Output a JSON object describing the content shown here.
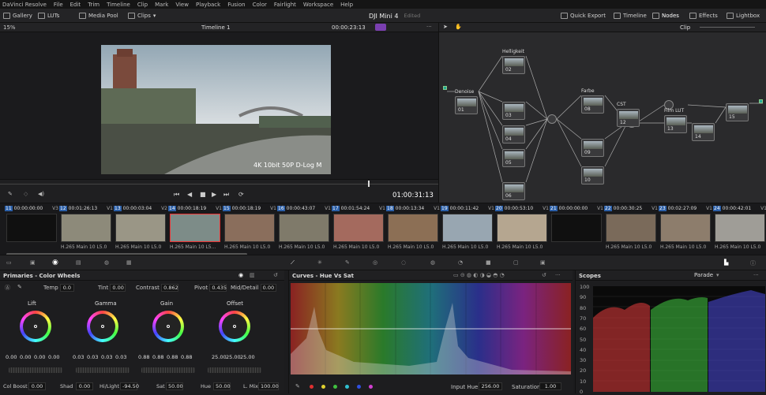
{
  "menu": [
    "DaVinci Resolve",
    "File",
    "Edit",
    "Trim",
    "Timeline",
    "Clip",
    "Mark",
    "View",
    "Playback",
    "Fusion",
    "Color",
    "Fairlight",
    "Workspace",
    "Help"
  ],
  "toolbar": {
    "gallery": "Gallery",
    "luts": "LUTs",
    "media_pool": "Media Pool",
    "clips": "Clips",
    "project": "DJI Mini 4",
    "edited": "Edited",
    "quick_export": "Quick Export",
    "timeline": "Timeline",
    "nodes": "Nodes",
    "effects": "Effects",
    "lightbox": "Lightbox"
  },
  "viewer": {
    "zoom": "15%",
    "timeline_name": "Timeline 1",
    "timecode": "00:00:23:13",
    "overlay_text": "4K 10bit 50P D-Log M",
    "playhead_tc": "01:00:31:13"
  },
  "nodes_header": {
    "mode": "Clip"
  },
  "nodes": [
    {
      "label": "Denoise",
      "num": "01"
    },
    {
      "label": "Helligkeit",
      "num": "02"
    },
    {
      "label": "",
      "num": "03"
    },
    {
      "label": "",
      "num": "04"
    },
    {
      "label": "",
      "num": "05"
    },
    {
      "label": "",
      "num": "06"
    },
    {
      "label": "Farbe",
      "num": "08"
    },
    {
      "label": "",
      "num": "09"
    },
    {
      "label": "",
      "num": "10"
    },
    {
      "label": "CST",
      "num": "12"
    },
    {
      "label": "Film LUT",
      "num": "13"
    },
    {
      "label": "",
      "num": "14"
    },
    {
      "label": "",
      "num": "15"
    }
  ],
  "clips": [
    {
      "n": "11",
      "tc": "00:00:00:00",
      "v": "V3",
      "codec": ""
    },
    {
      "n": "12",
      "tc": "00:01:26:13",
      "v": "V1",
      "codec": "H.265 Main 10 L5.0"
    },
    {
      "n": "13",
      "tc": "00:00:03:04",
      "v": "V2",
      "codec": "H.265 Main 10 L5.0"
    },
    {
      "n": "14",
      "tc": "00:00:18:19",
      "v": "V1",
      "codec": "H.265 Main 10 L5..."
    },
    {
      "n": "15",
      "tc": "00:00:18:19",
      "v": "V1",
      "codec": "H.265 Main 10 L5.0"
    },
    {
      "n": "16",
      "tc": "00:00:43:07",
      "v": "V1",
      "codec": "H.265 Main 10 L5.0"
    },
    {
      "n": "17",
      "tc": "00:01:54:24",
      "v": "V1",
      "codec": "H.265 Main 10 L5.0"
    },
    {
      "n": "18",
      "tc": "00:00:13:34",
      "v": "V1",
      "codec": "H.265 Main 10 L5.0"
    },
    {
      "n": "19",
      "tc": "00:00:11:42",
      "v": "V1",
      "codec": "H.265 Main 10 L5.0"
    },
    {
      "n": "20",
      "tc": "00:00:53:10",
      "v": "V1",
      "codec": "H.265 Main 10 L5.0"
    },
    {
      "n": "21",
      "tc": "00:00:00:00",
      "v": "V1",
      "codec": ""
    },
    {
      "n": "22",
      "tc": "00:00:30:25",
      "v": "V1",
      "codec": "H.265 Main 10 L5.0"
    },
    {
      "n": "23",
      "tc": "00:02:27:09",
      "v": "V1",
      "codec": "H.265 Main 10 L5.0"
    },
    {
      "n": "24",
      "tc": "00:00:42:01",
      "v": "V1",
      "codec": "H.265 Main 10 L5.0"
    }
  ],
  "primaries": {
    "title": "Primaries - Color Wheels",
    "temp_label": "Temp",
    "temp": "0.0",
    "tint_label": "Tint",
    "tint": "0.00",
    "contrast_label": "Contrast",
    "contrast": "0.862",
    "pivot_label": "Pivot",
    "pivot": "0.435",
    "middetail_label": "Mid/Detail",
    "middetail": "0.00",
    "wheels": [
      {
        "name": "Lift",
        "vals": [
          "0.00",
          "0.00",
          "0.00",
          "0.00"
        ]
      },
      {
        "name": "Gamma",
        "vals": [
          "0.03",
          "0.03",
          "0.03",
          "0.03"
        ]
      },
      {
        "name": "Gain",
        "vals": [
          "0.88",
          "0.88",
          "0.88",
          "0.88"
        ]
      },
      {
        "name": "Offset",
        "vals": [
          "25.00",
          "25.00",
          "25.00"
        ]
      }
    ],
    "colboost_label": "Col Boost",
    "colboost": "0.00",
    "shad_label": "Shad",
    "shad": "0.00",
    "hilight_label": "Hi/Light",
    "hilight": "-94.50",
    "sat_label": "Sat",
    "sat": "50.00",
    "hue_label": "Hue",
    "hue": "50.00",
    "lmix_label": "L. Mix",
    "lmix": "100.00"
  },
  "curves": {
    "title": "Curves - Hue Vs Sat",
    "input_hue_label": "Input Hue",
    "input_hue": "256.00",
    "saturation_label": "Saturation",
    "saturation": "1.00",
    "swatch_colors": [
      "#e03030",
      "#e0d030",
      "#40c040",
      "#30c0d0",
      "#3050e0",
      "#d040d0"
    ]
  },
  "scopes": {
    "title": "Scopes",
    "mode": "Parade",
    "ticks": [
      "100",
      "90",
      "80",
      "70",
      "60",
      "50",
      "40",
      "30",
      "20",
      "10",
      "0"
    ]
  }
}
